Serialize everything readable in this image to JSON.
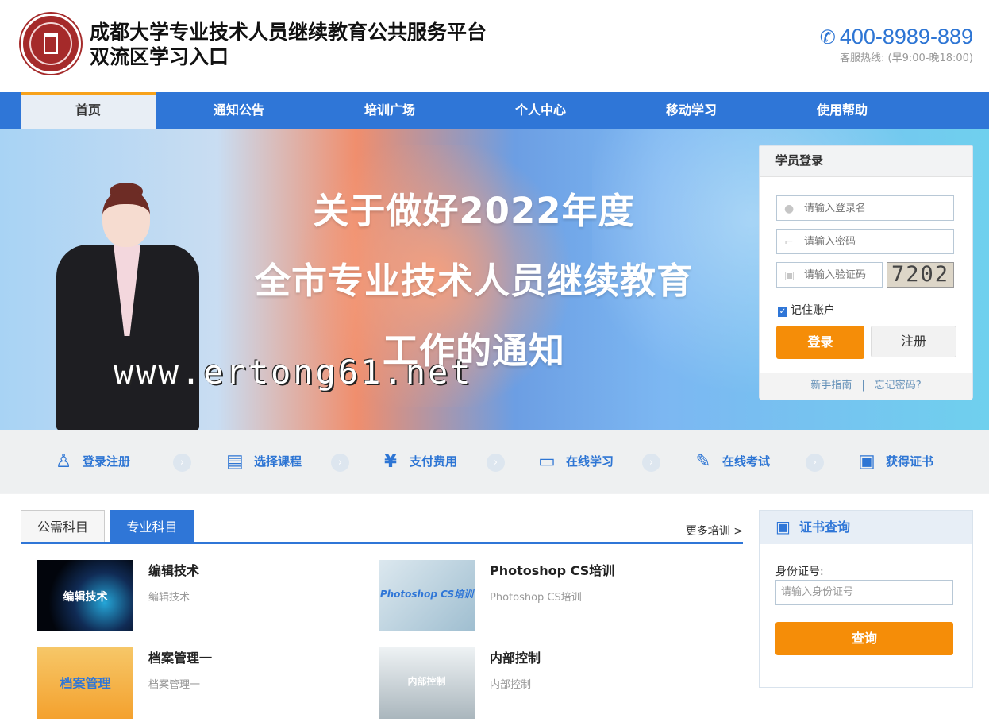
{
  "header": {
    "title_line1": "成都大学专业技术人员继续教育公共服务平台",
    "title_line2": "双流区学习入口",
    "phone": "400-8989-889",
    "phone_hint": "客服热线: (早9:00-晚18:00)"
  },
  "nav": {
    "items": [
      "首页",
      "通知公告",
      "培训广场",
      "个人中心",
      "移动学习",
      "使用帮助"
    ],
    "active": "首页"
  },
  "banner": {
    "lines": [
      "关于做好2022年度",
      "全市专业技术人员继续教育",
      "工作的通知"
    ],
    "watermark": "www.ertong61.net"
  },
  "login": {
    "title": "学员登录",
    "username_placeholder": "请输入登录名",
    "password_placeholder": "请输入密码",
    "code_placeholder": "请输入验证码",
    "captcha": "7202",
    "remember": "记住账户",
    "login_button": "登录",
    "register_button": "注册",
    "guide": "新手指南",
    "forgot": "忘记密码?"
  },
  "steps": [
    "登录注册",
    "选择课程",
    "支付费用",
    "在线学习",
    "在线考试",
    "获得证书"
  ],
  "courses": {
    "tabs": [
      "公需科目",
      "专业科目"
    ],
    "active_tab": "专业科目",
    "more": "更多培训 >",
    "items": [
      {
        "title": "编辑技术",
        "subtitle": "编辑技术",
        "image_text": "编辑技术"
      },
      {
        "title": "Photoshop CS培训",
        "subtitle": "Photoshop CS培训",
        "image_text": "Photoshop CS培训"
      },
      {
        "title": "档案管理一",
        "subtitle": "档案管理一",
        "image_text": "档案管理"
      },
      {
        "title": "内部控制",
        "subtitle": "内部控制",
        "image_text": "内部控制"
      }
    ]
  },
  "certificate": {
    "title": "证书查询",
    "id_label": "身份证号:",
    "id_placeholder": "请输入身份证号",
    "query_button": "查询"
  },
  "icons": {
    "phone": "phone-icon",
    "user": "user-icon",
    "key": "key-icon",
    "captcha": "captcha-icon",
    "step_arrow": "chevron-right-icon",
    "certificate": "certificate-icon"
  },
  "colors": {
    "primary": "#2f76d7",
    "accent": "#f58d08",
    "banner_left": "#a8d3f4",
    "banner_right": "#6fd0ee"
  }
}
